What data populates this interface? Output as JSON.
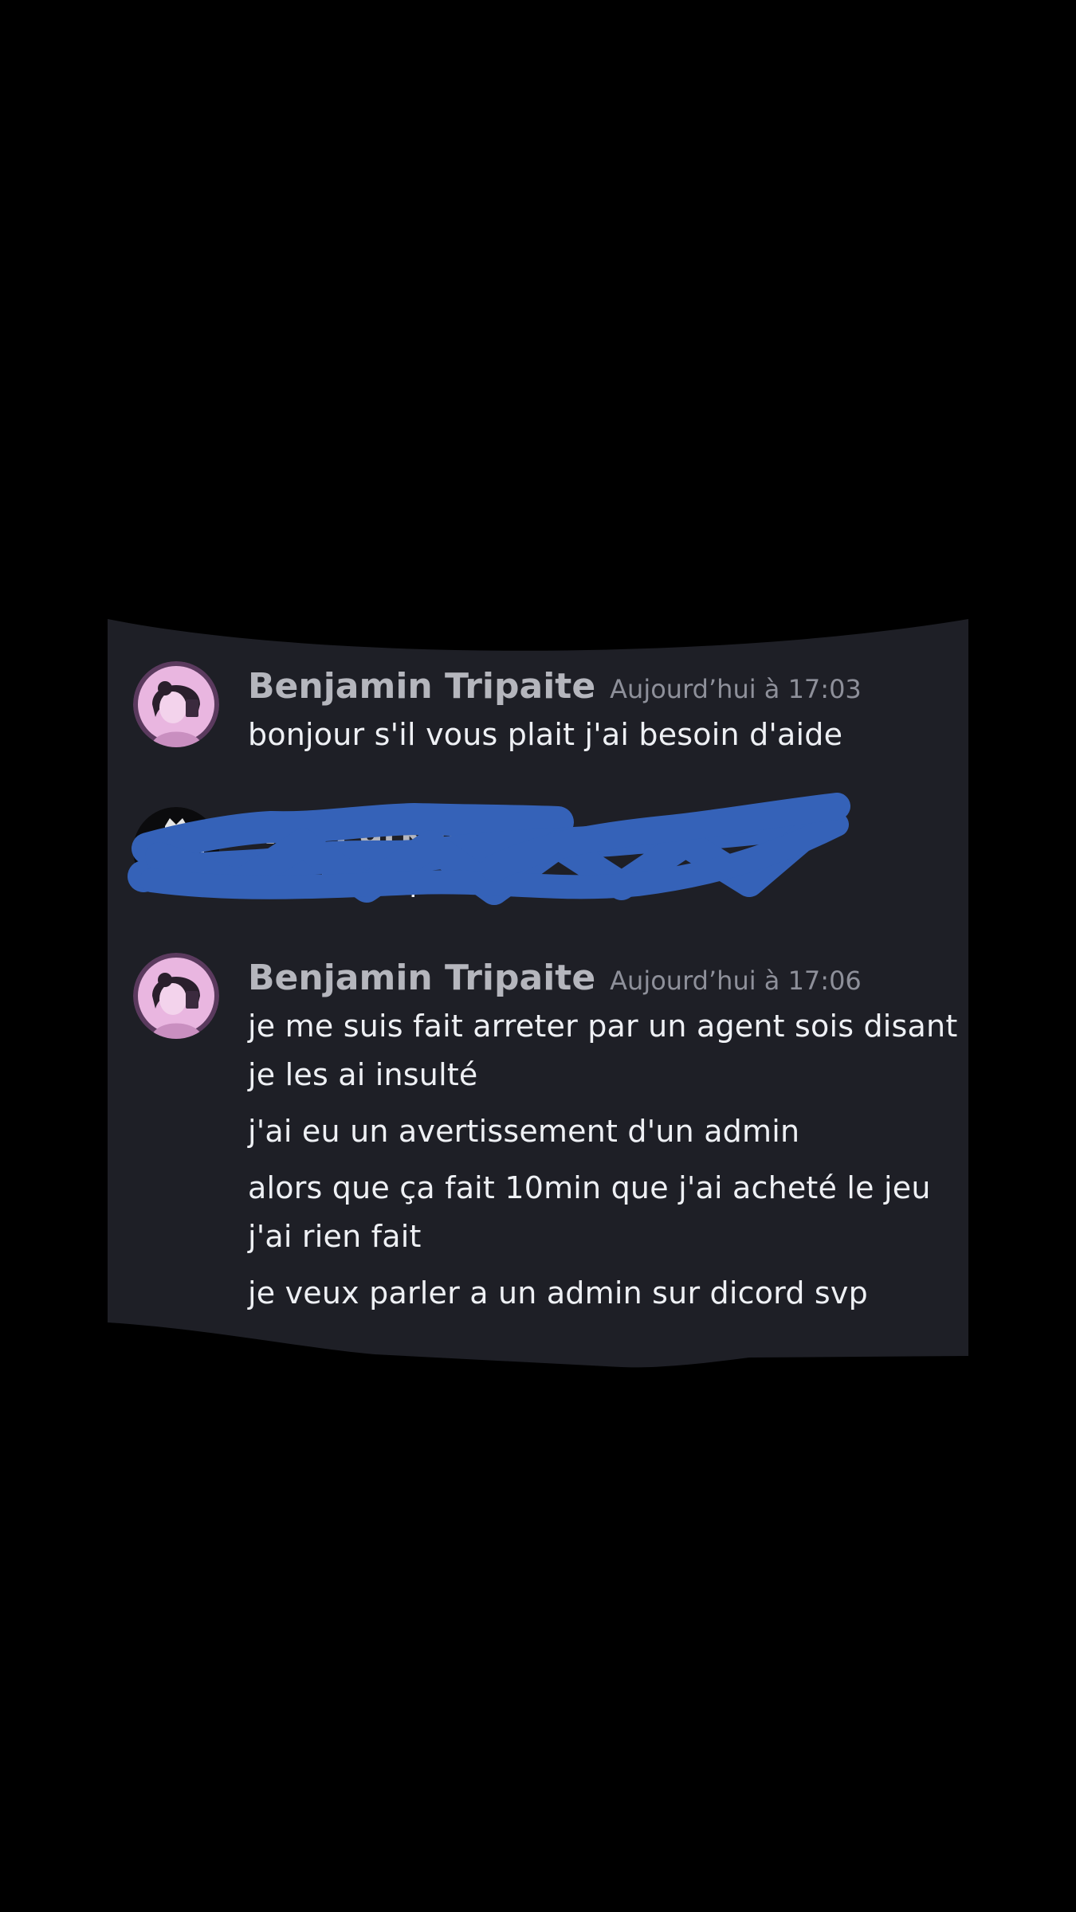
{
  "colors": {
    "page_background": "#000000",
    "chat_background": "#1e1f26",
    "author_name": "#b5b6bd",
    "timestamp": "#8e909a",
    "message_text": "#eef0f4",
    "redaction_scribble": "#3562b8"
  },
  "messages": [
    {
      "author": "Benjamin Tripaite",
      "timestamp": "Aujourd’hui à 17:03",
      "avatar": "illustrated-woman-avatar",
      "lines": [
        "bonjour s'il vous plait j'ai besoin d'aide"
      ]
    },
    {
      "author": "Ni  s Park",
      "timestamp": "Auj  à 1",
      "avatar": "crown-laurel-avatar",
      "lines": [
        "omment peux ?"
      ],
      "redacted": true
    },
    {
      "author": "Benjamin Tripaite",
      "timestamp": "Aujourd’hui à 17:06",
      "avatar": "illustrated-woman-avatar",
      "lines": [
        "je me suis fait arreter par un agent sois disant",
        "je les ai insulté",
        "j'ai eu un avertissement d'un admin",
        "alors que ça fait 10min que j'ai acheté le jeu",
        "j'ai rien fait",
        "je veux parler a un admin sur dicord svp"
      ]
    }
  ]
}
